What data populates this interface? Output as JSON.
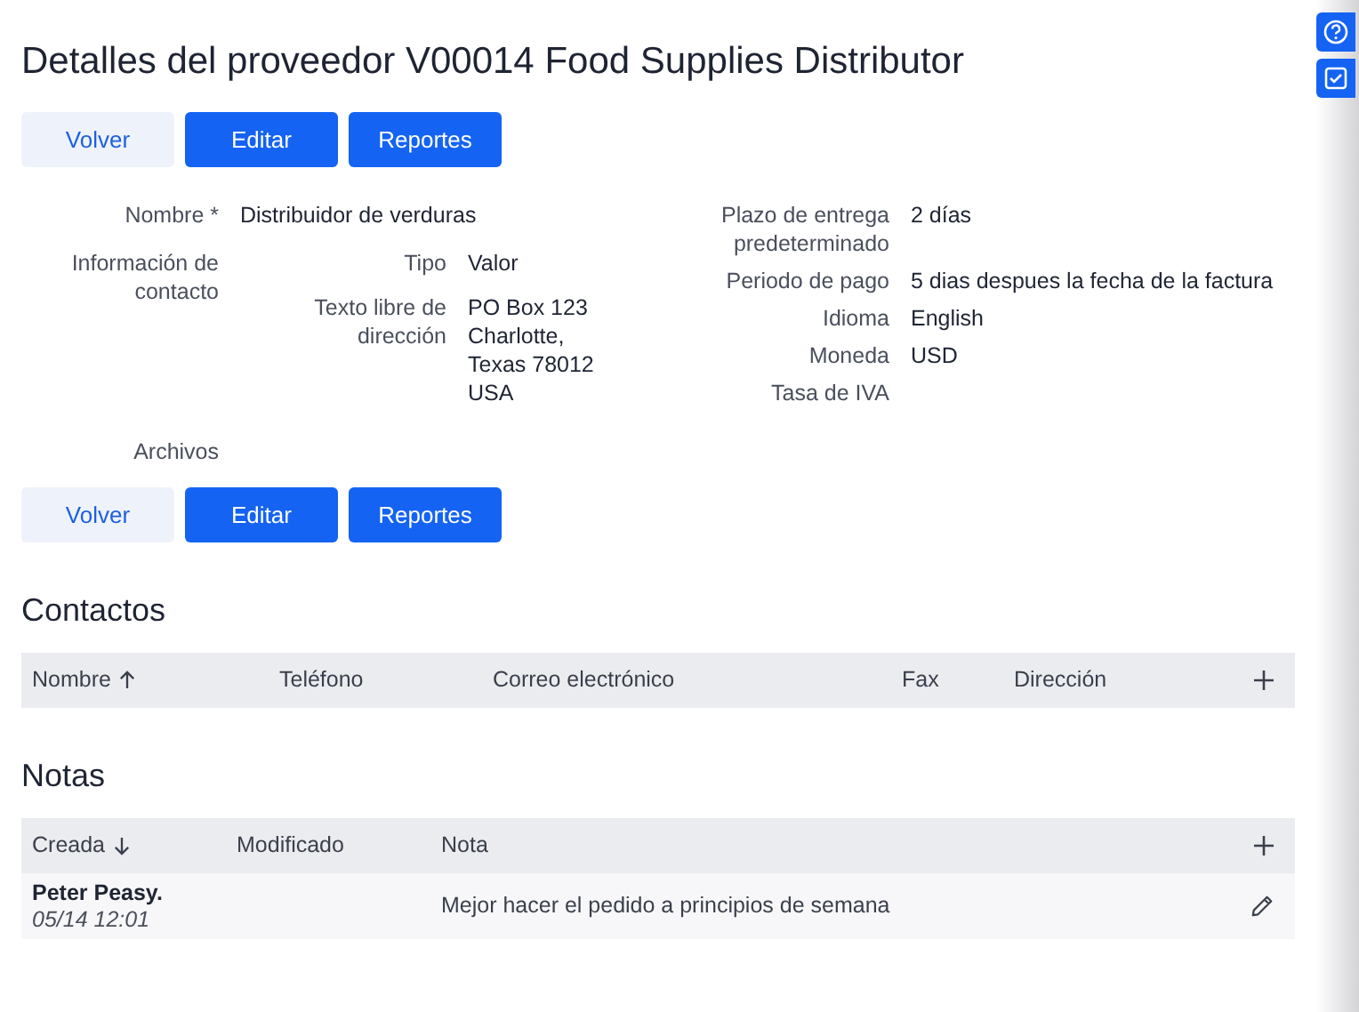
{
  "title": "Detalles del proveedor V00014 Food Supplies Distributor",
  "actions": [
    {
      "label": "Volver",
      "kind": "secondary"
    },
    {
      "label": "Editar",
      "kind": "primary"
    },
    {
      "label": "Reportes",
      "kind": "primary"
    }
  ],
  "details_left": [
    {
      "label": "Nombre *",
      "value": "Distribuidor de verduras"
    },
    {
      "label": "Información de contacto",
      "contact": {
        "header": {
          "label": "Tipo",
          "value": "Valor"
        },
        "rows": [
          {
            "label": "Texto libre de dirección",
            "value": "PO Box 123\nCharlotte,\nTexas 78012\nUSA"
          }
        ]
      }
    },
    {
      "label": "Archivos"
    }
  ],
  "details_right": [
    {
      "label": "Plazo de entrega predeterminado",
      "value": "2 días"
    },
    {
      "label": "Periodo de pago",
      "value": "5 dias despues la fecha de la factura"
    },
    {
      "label": "Idioma",
      "value": "English"
    },
    {
      "label": "Moneda",
      "value": "USD"
    },
    {
      "label": "Tasa de IVA"
    }
  ],
  "bottom_actions": [
    {
      "label": "Volver",
      "kind": "secondary"
    },
    {
      "label": "Editar",
      "kind": "primary"
    },
    {
      "label": "Reportes",
      "kind": "primary"
    }
  ],
  "contacts": {
    "heading": "Contactos",
    "columns": [
      {
        "label": "Nombre",
        "sorted": true,
        "descending": false
      },
      {
        "label": "Teléfono",
        "sorted": false
      },
      {
        "label": "Correo electrónico",
        "sorted": false
      },
      {
        "label": "Fax",
        "sorted": false
      },
      {
        "label": "Dirección",
        "sorted": false
      }
    ]
  },
  "notes": {
    "heading": "Notas",
    "columns": [
      {
        "label": "Creada",
        "sorted": true,
        "descending": true
      },
      {
        "label": "Modificado",
        "sorted": false
      },
      {
        "label": "Nota",
        "sorted": false
      }
    ],
    "rows": [
      {
        "author": "Peter Peasy.",
        "date": "05/14 12:01",
        "note": "Mejor hacer el pedido a principios de semana"
      }
    ]
  },
  "side_buttons": [
    {
      "kind": "help"
    },
    {
      "kind": "tasks"
    }
  ]
}
